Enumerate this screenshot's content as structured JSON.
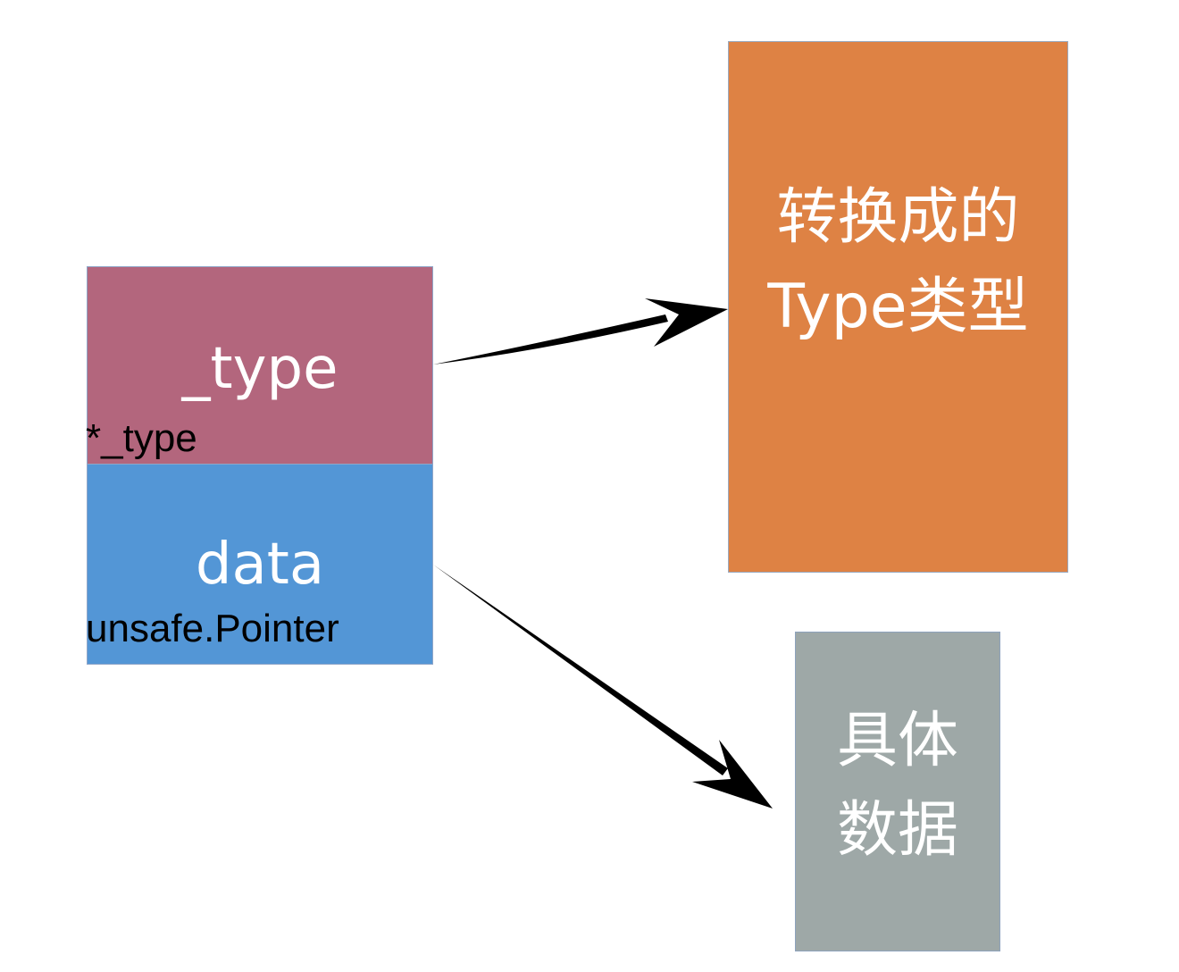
{
  "struct": {
    "type_field": {
      "name": "_type",
      "type": "*_type"
    },
    "data_field": {
      "name": "data",
      "type": "unsafe.Pointer"
    }
  },
  "targets": {
    "type_box": {
      "line1": "转换成的",
      "line2": "Type类型"
    },
    "data_box": {
      "line1": "具体",
      "line2": "数据"
    }
  },
  "colors": {
    "type_field": "#b3667d",
    "data_field": "#5396d6",
    "type_box": "#de8244",
    "data_box": "#9ea8a7",
    "arrow": "#000000"
  }
}
